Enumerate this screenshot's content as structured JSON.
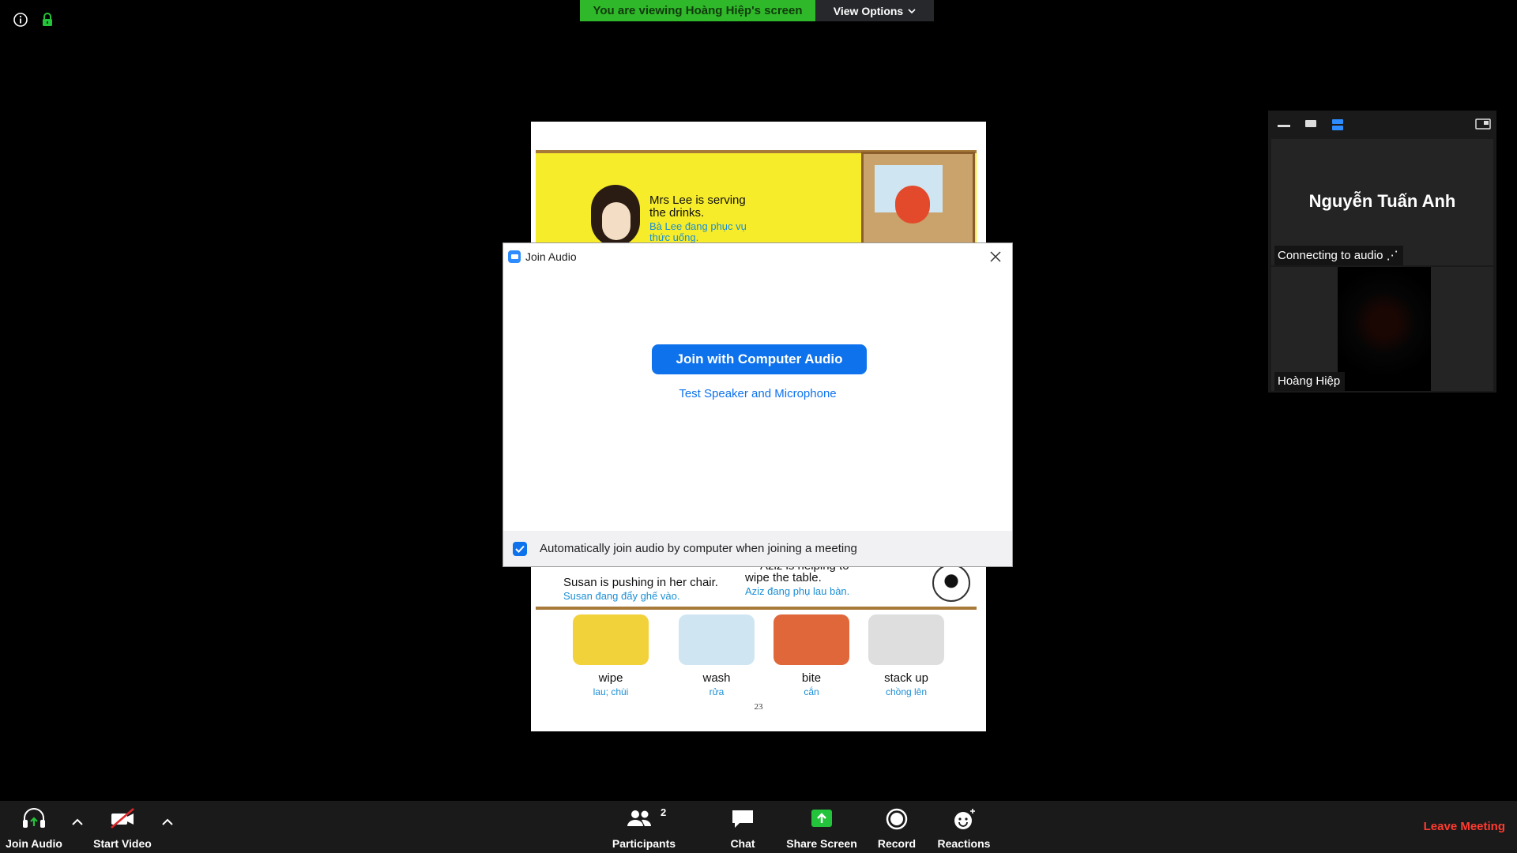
{
  "banner": {
    "viewing_prefix": "You are viewing",
    "viewing_name": "Hoàng Hiệp's screen",
    "view_options": "View Options"
  },
  "shared_screen": {
    "top_sentence_en": "Mrs Lee is serving the drinks.",
    "top_sentence_vi": "Bà Lee đang phục vụ thức uống.",
    "left_sentence_en": "Susan is pushing in her chair.",
    "left_sentence_vi": "Susan đang đẩy ghế vào.",
    "right_sentence_en_partial": "Aziz is helping to",
    "right_sentence_en": "wipe the table.",
    "right_sentence_vi": "Aziz đang phụ lau bàn.",
    "vocab": [
      {
        "word": "wipe",
        "meaning": "lau; chùi"
      },
      {
        "word": "wash",
        "meaning": "rửa"
      },
      {
        "word": "bite",
        "meaning": "cắn"
      },
      {
        "word": "stack up",
        "meaning": "chồng lên"
      }
    ],
    "page_number": "23"
  },
  "dialog": {
    "title": "Join Audio",
    "join_button": "Join with Computer Audio",
    "test_link": "Test Speaker and Microphone",
    "auto_join_label": "Automatically join audio by computer when joining a meeting",
    "auto_join_checked": true
  },
  "panel": {
    "participant1_name": "Nguyễn Tuấn Anh",
    "participant1_status": "Connecting to audio",
    "participant2_name": "Hoàng Hiệp"
  },
  "toolbar": {
    "join_audio": "Join Audio",
    "start_video": "Start Video",
    "participants": "Participants",
    "participants_count": "2",
    "chat": "Chat",
    "share_screen": "Share Screen",
    "record": "Record",
    "reactions": "Reactions",
    "leave": "Leave Meeting"
  },
  "colors": {
    "accent_blue": "#0e72ed",
    "banner_green": "#2fb82a",
    "share_green": "#23c33b",
    "leave_red": "#ff3b30"
  },
  "icons": [
    "info-icon",
    "lock-icon",
    "chevron-down-icon",
    "zoom-app-icon",
    "close-icon",
    "check-icon",
    "headphones-icon",
    "video-off-icon",
    "participants-icon",
    "chat-icon",
    "share-screen-icon",
    "record-icon",
    "reactions-icon"
  ]
}
